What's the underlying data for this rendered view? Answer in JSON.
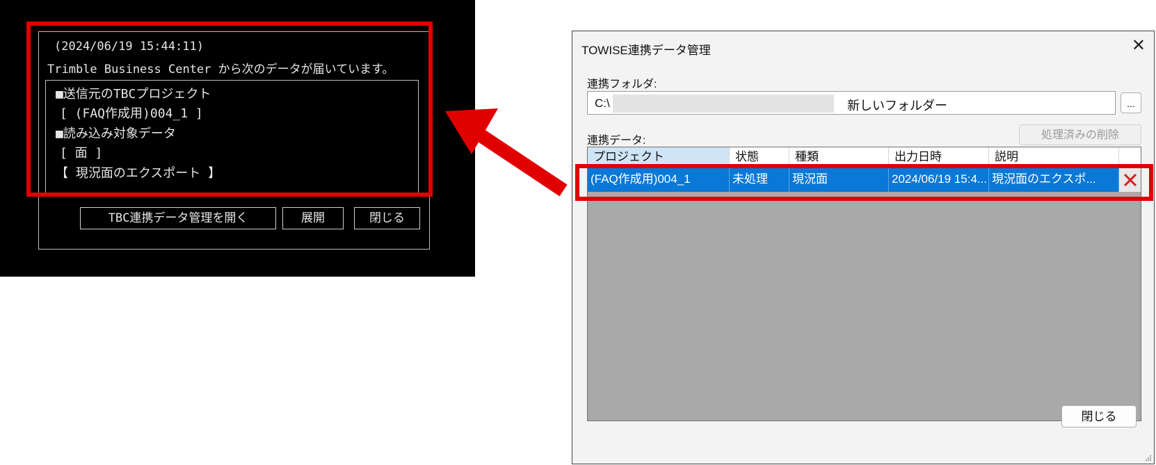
{
  "notification": {
    "timestamp": "(2024/06/19 15:44:11)",
    "message": "Trimble Business Center から次のデータが届いています。",
    "source_label": "■送信元のTBCプロジェクト",
    "source_value": "[ (FAQ作成用)004_1 ]",
    "target_label": "■読み込み対象データ",
    "target_value": "[ 面 ]",
    "export_note": "【 現況面のエクスポート 】",
    "buttons": {
      "open_manager": "TBC連携データ管理を開く",
      "expand": "展開",
      "close": "閉じる"
    }
  },
  "dialog": {
    "title": "TOWISE連携データ管理",
    "close_glyph": "✕",
    "folder_label": "連携フォルダ:",
    "folder_prefix": "C:\\",
    "folder_suffix": "新しいフォルダー",
    "browse_label": "...",
    "data_label": "連携データ:",
    "delete_processed": "処理済みの削除",
    "columns": [
      "プロジェクト",
      "状態",
      "種類",
      "出力日時",
      "説明"
    ],
    "rows": [
      {
        "project": "(FAQ作成用)004_1",
        "status": "未処理",
        "type": "現況面",
        "output_datetime": "2024/06/19 15:4...",
        "description": "現況面のエクスポ..."
      }
    ],
    "close_button": "閉じる"
  },
  "colors": {
    "highlight": "#e10000",
    "selection": "#0a78d7",
    "delete_x": "#d22020"
  }
}
